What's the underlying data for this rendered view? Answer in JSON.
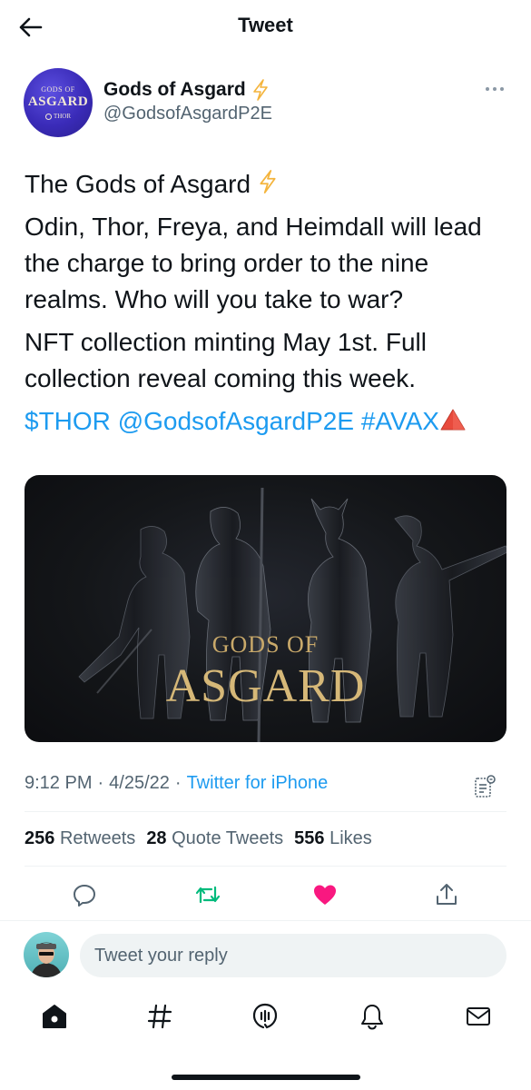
{
  "header": {
    "title": "Tweet",
    "back_icon": "arrow-left-icon"
  },
  "author": {
    "avatar": {
      "line1": "GODS OF",
      "line2": "ASGARD",
      "line3": "THOR"
    },
    "display_name": "Gods of Asgard",
    "handle": "@GodsofAsgardP2E",
    "badge_icon": "lightning-icon"
  },
  "tweet": {
    "line1": "The Gods of Asgard",
    "paragraph1": "Odin, Thor, Freya, and Heimdall will lead the charge to bring order to the nine realms. Who will you take to war?",
    "paragraph2": "NFT collection minting May 1st. Full collection reveal coming this week.",
    "links": {
      "cashtag": "$THOR",
      "mention": "@GodsofAsgardP2E",
      "hashtag": "#AVAX"
    }
  },
  "media": {
    "title_small": "GODS OF",
    "title_big": "ASGARD"
  },
  "meta": {
    "time": "9:12 PM",
    "date": "4/25/22",
    "source": "Twitter for iPhone",
    "separator": "·"
  },
  "counts": {
    "retweets": {
      "value": "256",
      "label": "Retweets"
    },
    "quote_tweets": {
      "value": "28",
      "label": "Quote Tweets"
    },
    "likes": {
      "value": "556",
      "label": "Likes"
    }
  },
  "reply": {
    "placeholder": "Tweet your reply"
  },
  "colors": {
    "link": "#1d9bf0",
    "retweet": "#00ba7c",
    "like": "#f91880",
    "text": "#0f1419",
    "secondary": "#536471"
  },
  "tabs": [
    "home-icon",
    "explore-icon",
    "spaces-icon",
    "notifications-icon",
    "messages-icon"
  ]
}
